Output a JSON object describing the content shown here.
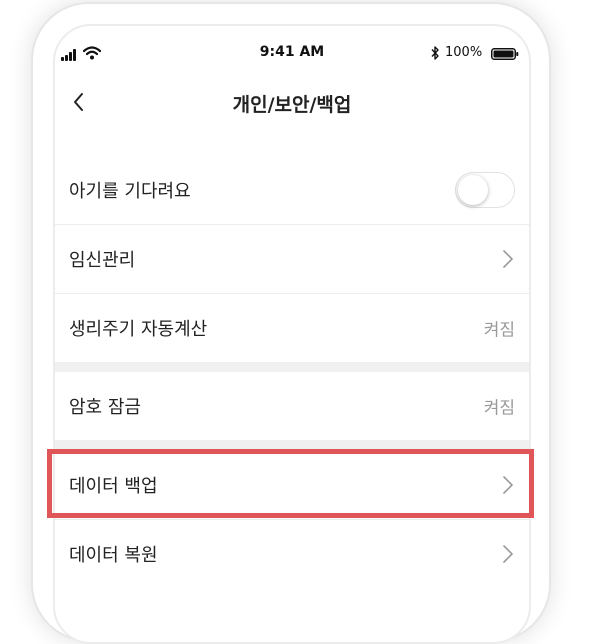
{
  "status_bar": {
    "time": "9:41 AM",
    "battery_percent": "100%"
  },
  "nav": {
    "title": "개인/보안/백업"
  },
  "settings": {
    "baby_expecting": {
      "label": "아기를 기다려요",
      "enabled": false
    },
    "pregnancy_management": {
      "label": "임신관리"
    },
    "auto_period_calc": {
      "label": "생리주기 자동계산",
      "value": "켜짐"
    },
    "passcode_lock": {
      "label": "암호 잠금",
      "value": "켜짐"
    },
    "data_backup": {
      "label": "데이터 백업"
    },
    "data_restore": {
      "label": "데이터 복원"
    }
  },
  "colors": {
    "highlight": "#e05658",
    "section_gap": "#f0f0f0",
    "value_text": "#9a9a9a"
  },
  "icons": [
    "signal-icon",
    "wifi-icon",
    "bluetooth-icon",
    "battery-icon",
    "back-chevron-icon",
    "chevron-right-icon"
  ]
}
